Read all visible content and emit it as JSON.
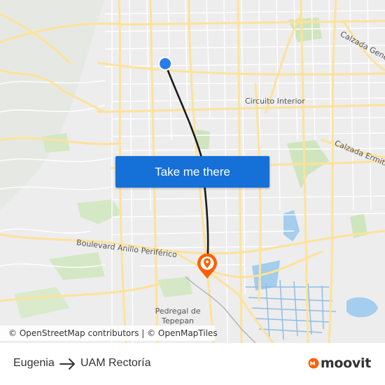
{
  "map": {
    "street_labels": [
      "Calzada Gene",
      "Circuito Interior",
      "Calzada Ermita",
      "Boulevard Anillo Periférico"
    ],
    "place_labels": [
      "Pedregal de Tepepan"
    ],
    "origin_marker": "origin-dot-icon",
    "destination_marker": "destination-pin-icon",
    "route_color": "#1a1a1a"
  },
  "cta": {
    "label": "Take me there"
  },
  "attribution": {
    "text": "© OpenStreetMap contributors | © OpenMapTiles"
  },
  "route": {
    "from": "Eugenia",
    "to": "UAM Rectoría",
    "arrow_icon": "arrow-right-icon"
  },
  "brand": {
    "name": "moovit",
    "color": "#ff5f00"
  },
  "colors": {
    "road": "#fde9a8",
    "road_minor": "#ffffff",
    "water": "#a4cdee",
    "park": "#cfe5bd",
    "cta": "#1570d8"
  }
}
